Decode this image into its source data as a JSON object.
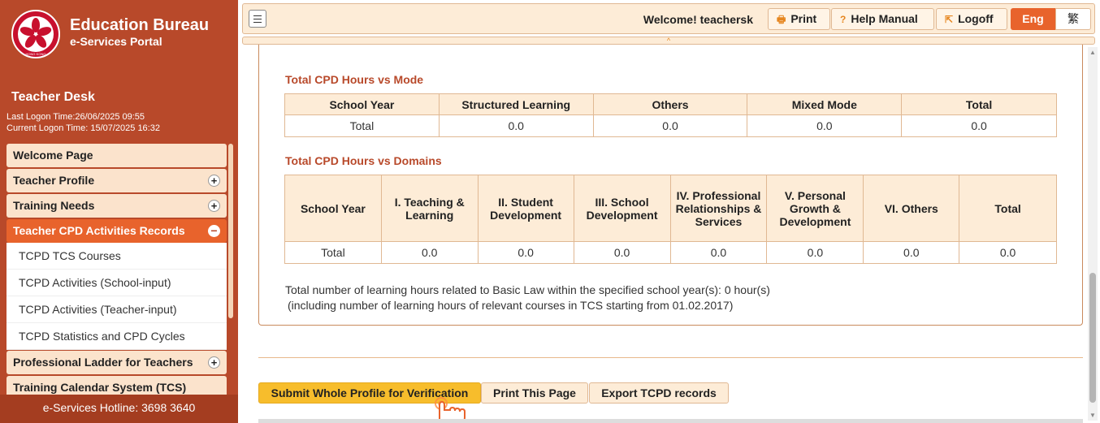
{
  "sidebar": {
    "portal_title": "Education Bureau",
    "portal_subtitle": "e-Services Portal",
    "emblem_text": "HONG KONG",
    "desk_title": "Teacher Desk",
    "last_logon": "Last Logon Time:26/06/2025 09:55",
    "current_logon": "Current Logon Time: 15/07/2025 16:32",
    "menu": [
      {
        "label": "Welcome Page",
        "expander": ""
      },
      {
        "label": "Teacher Profile",
        "expander": "+"
      },
      {
        "label": "Training Needs",
        "expander": "+"
      },
      {
        "label": "Teacher CPD Activities Records",
        "expander": "−"
      },
      {
        "label": "TCPD TCS Courses"
      },
      {
        "label": "TCPD Activities (School-input)"
      },
      {
        "label": "TCPD Activities (Teacher-input)"
      },
      {
        "label": "TCPD Statistics and CPD Cycles"
      },
      {
        "label": "Professional Ladder for Teachers",
        "expander": "+"
      },
      {
        "label": "Training Calendar System (TCS)"
      }
    ],
    "hotline": "e-Services Hotline: 3698 3640"
  },
  "topbar": {
    "welcome": "Welcome! teachersk",
    "print_label": "Print",
    "help_label": "Help Manual",
    "logoff_label": "Logoff",
    "lang_en": "Eng",
    "lang_zh": "繁",
    "collapse_glyph": "^"
  },
  "mode_table": {
    "title": "Total CPD Hours vs Mode",
    "headers": [
      "School Year",
      "Structured Learning",
      "Others",
      "Mixed Mode",
      "Total"
    ],
    "row": [
      "Total",
      "0.0",
      "0.0",
      "0.0",
      "0.0"
    ]
  },
  "domain_table": {
    "title": "Total CPD Hours vs Domains",
    "headers": [
      "School Year",
      "I. Teaching & Learning",
      "II. Student Development",
      "III. School Development",
      "IV. Professional Relationships & Services",
      "V. Personal Growth & Development",
      "VI. Others",
      "Total"
    ],
    "row": [
      "Total",
      "0.0",
      "0.0",
      "0.0",
      "0.0",
      "0.0",
      "0.0",
      "0.0"
    ]
  },
  "notes": {
    "line1": "Total number of learning hours related to Basic Law within the specified school year(s): 0 hour(s)",
    "line2": "(including number of learning hours of relevant courses in TCS starting from 01.02.2017)"
  },
  "actions": {
    "submit": "Submit Whole Profile for Verification",
    "print_page": "Print This Page",
    "export": "Export TCPD records"
  },
  "colors": {
    "sidebar_bg": "#b8492a",
    "accent_orange": "#e8632c",
    "header_bg": "#fdecd7",
    "submit_bg": "#f7bd2c",
    "title_color": "#b8492a"
  }
}
